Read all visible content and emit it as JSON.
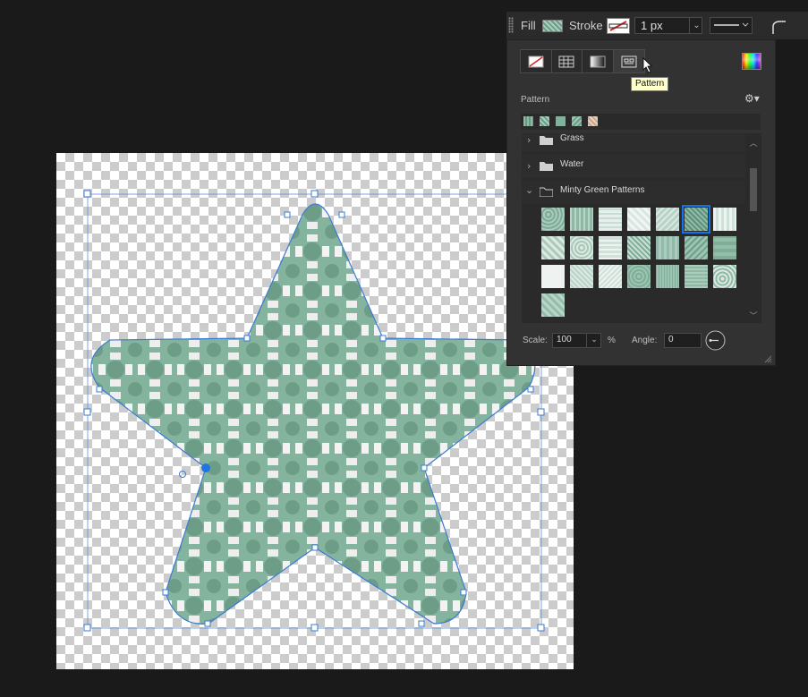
{
  "toolbar": {
    "fill_label": "Fill",
    "stroke_label": "Stroke",
    "stroke_width": "1 px"
  },
  "panel": {
    "tooltip": "Pattern",
    "section_label": "Pattern",
    "folders": [
      {
        "name": "Grass",
        "expanded": false
      },
      {
        "name": "Water",
        "expanded": false
      },
      {
        "name": "Minty Green Patterns",
        "expanded": true
      }
    ],
    "scale_label": "Scale:",
    "scale_value": "100",
    "percent_sign": "%",
    "angle_label": "Angle:",
    "angle_value": "0"
  },
  "colors": {
    "background": "#1a1a1a",
    "panel": "#323232",
    "selection": "#1473e6",
    "mint": "#84b39e"
  },
  "icons": [
    "gear-icon",
    "folder-icon",
    "chevron-right-icon",
    "chevron-down-icon",
    "color-picker-icon",
    "angle-dial-icon"
  ]
}
